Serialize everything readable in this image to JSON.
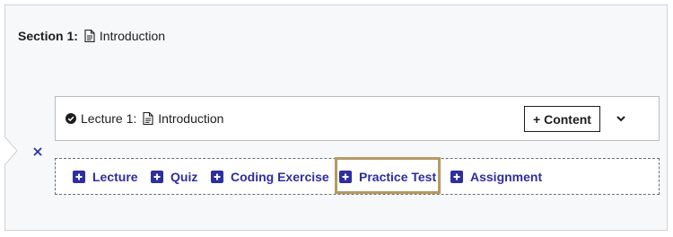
{
  "section": {
    "label": "Section 1:",
    "title": "Introduction"
  },
  "lecture": {
    "label": "Lecture 1:",
    "title": "Introduction",
    "content_button": "+ Content",
    "status": "published"
  },
  "add_options": [
    {
      "label": "Lecture"
    },
    {
      "label": "Quiz"
    },
    {
      "label": "Coding Exercise"
    },
    {
      "label": "Practice Test"
    },
    {
      "label": "Assignment"
    }
  ],
  "icons": {
    "section_doc": "document-icon",
    "lecture_check": "check-circle-icon",
    "lecture_doc": "document-icon",
    "expand": "chevron-down-icon",
    "close": "close-icon",
    "add": "plus-square-icon"
  },
  "colors": {
    "accent": "#2d2f9e",
    "highlight": "#b59a62",
    "panel_bg": "#f7f8fa"
  }
}
